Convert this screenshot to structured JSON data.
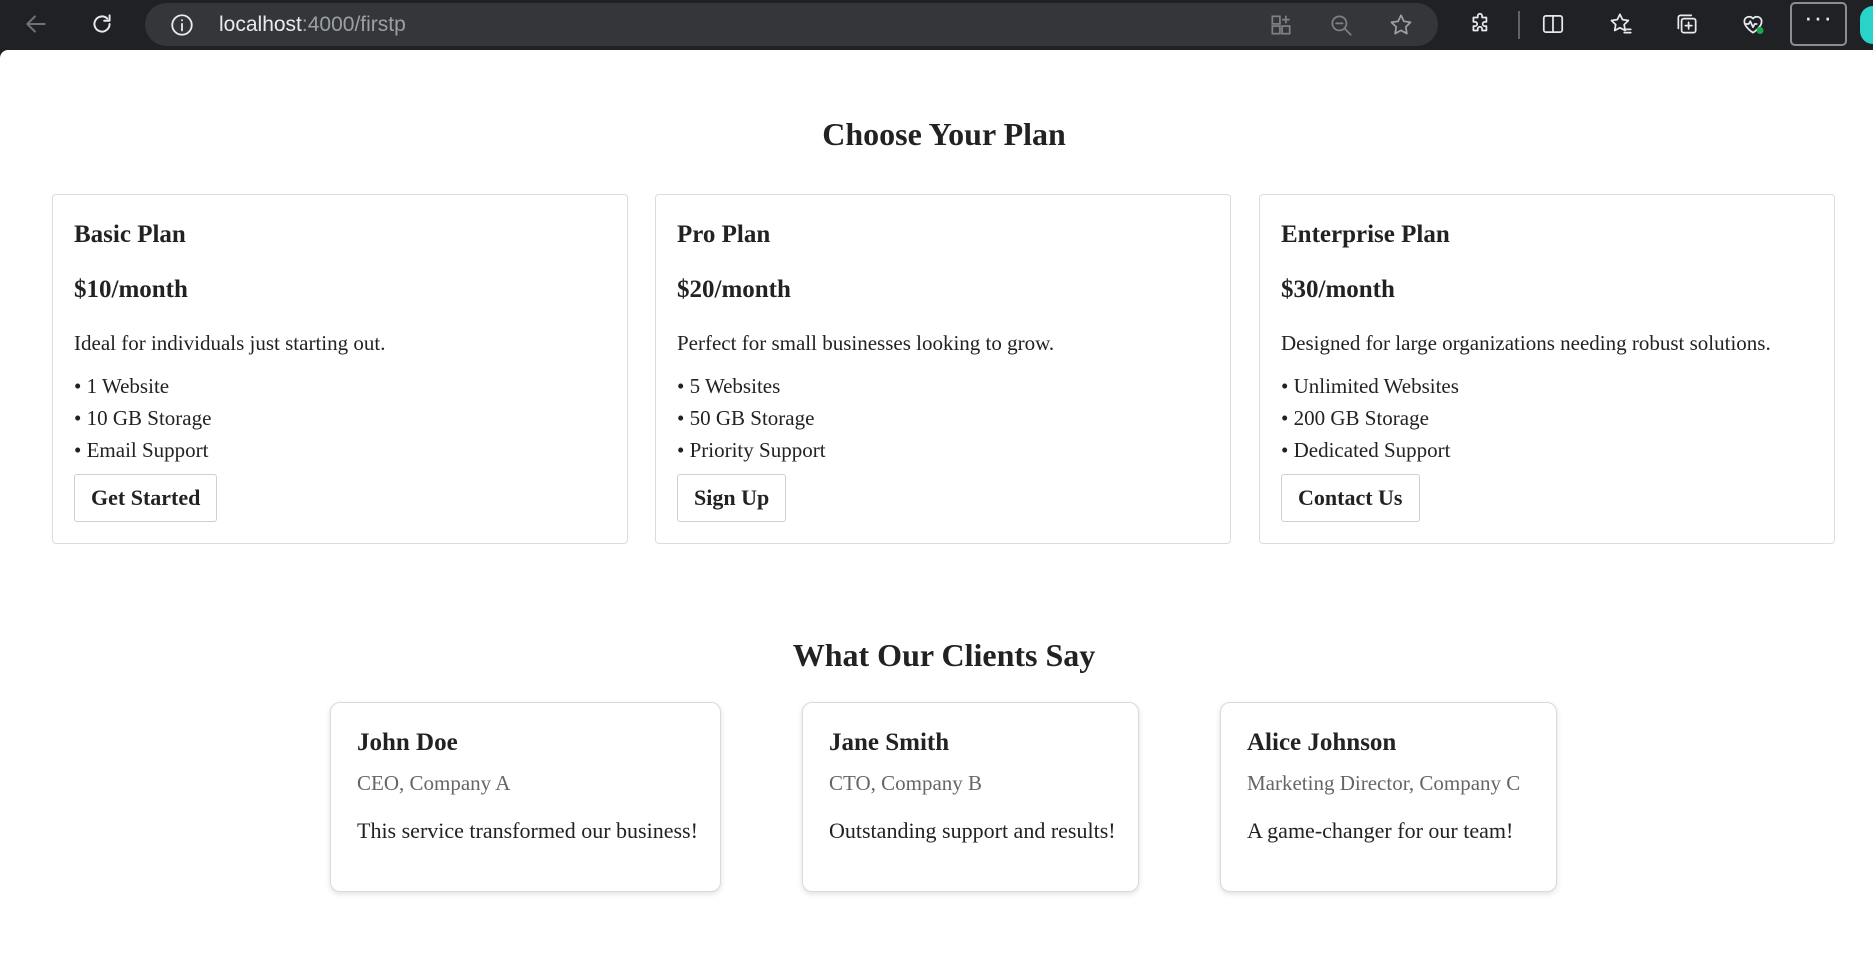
{
  "browser": {
    "url_host": "localhost",
    "url_path": ":4000/firstp",
    "icons": {
      "back": "back-arrow-icon",
      "reload": "reload-icon",
      "info": "info-icon",
      "apps": "app-available-icon",
      "zoom": "zoom-out-icon",
      "favorite": "favorite-star-icon",
      "extensions": "extensions-icon",
      "split": "split-screen-icon",
      "favorites": "favorites-icon",
      "collections": "collections-icon",
      "health": "browser-essentials-icon",
      "more": "more-icon"
    },
    "more_label": "···"
  },
  "pricing": {
    "title": "Choose Your Plan",
    "plans": [
      {
        "name": "Basic Plan",
        "price": "$10/month",
        "description": "Ideal for individuals just starting out.",
        "features": [
          "• 1 Website",
          "• 10 GB Storage",
          "• Email Support"
        ],
        "button": "Get Started"
      },
      {
        "name": "Pro Plan",
        "price": "$20/month",
        "description": "Perfect for small businesses looking to grow.",
        "features": [
          "• 5 Websites",
          "• 50 GB Storage",
          "• Priority Support"
        ],
        "button": "Sign Up"
      },
      {
        "name": "Enterprise Plan",
        "price": "$30/month",
        "description": "Designed for large organizations needing robust solutions.",
        "features": [
          "• Unlimited Websites",
          "• 200 GB Storage",
          "• Dedicated Support"
        ],
        "button": "Contact Us"
      }
    ]
  },
  "testimonials": {
    "title": "What Our Clients Say",
    "items": [
      {
        "name": "John Doe",
        "role": "CEO, Company A",
        "quote": "This service transformed our business!"
      },
      {
        "name": "Jane Smith",
        "role": "CTO, Company B",
        "quote": "Outstanding support and results!"
      },
      {
        "name": "Alice Johnson",
        "role": "Marketing Director, Company C",
        "quote": "A game-changer for our team!"
      }
    ]
  },
  "colors": {
    "chrome_bg": "#202124",
    "omnibox_bg": "#35363a",
    "text": "#222222",
    "muted_text": "#666666",
    "border": "#dcdcdc"
  }
}
